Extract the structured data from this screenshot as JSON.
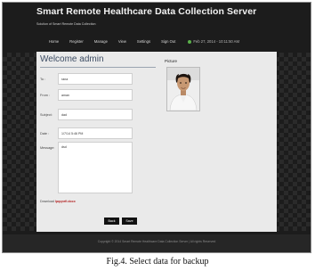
{
  "header": {
    "title": "Smart Remote Healthcare Data Collection Server",
    "subtitle": "Solution of Smart Remote Data Collection"
  },
  "nav": {
    "items": [
      {
        "label": "Home"
      },
      {
        "label": "Register"
      },
      {
        "label": "Manage"
      },
      {
        "label": "View"
      },
      {
        "label": "Settings"
      },
      {
        "label": "Sign Out"
      }
    ],
    "datetime": "Feb 27, 2014 - 10:11:50 AM"
  },
  "main": {
    "welcome": "Welcome admin",
    "fields": [
      {
        "label": "To :",
        "value": "rana"
      },
      {
        "label": "From :",
        "value": "aman"
      },
      {
        "label": "Subject:",
        "value": "dad"
      },
      {
        "label": "Date :",
        "value": "1/7/14 5:46 PM"
      }
    ],
    "message": {
      "label": "Message:",
      "value": "dsd"
    },
    "download": {
      "prefix": "Download",
      "filename": "lpqqnrfi.docx"
    },
    "buttons": {
      "back": "Back",
      "save": "Save"
    },
    "picture_label": "Picture"
  },
  "footer": {
    "copyright": "Copyright © 2014 Smart Remote Healthcare Data Collection Server | All rights Reserved"
  },
  "caption": "Fig.4. Select data for backup"
}
